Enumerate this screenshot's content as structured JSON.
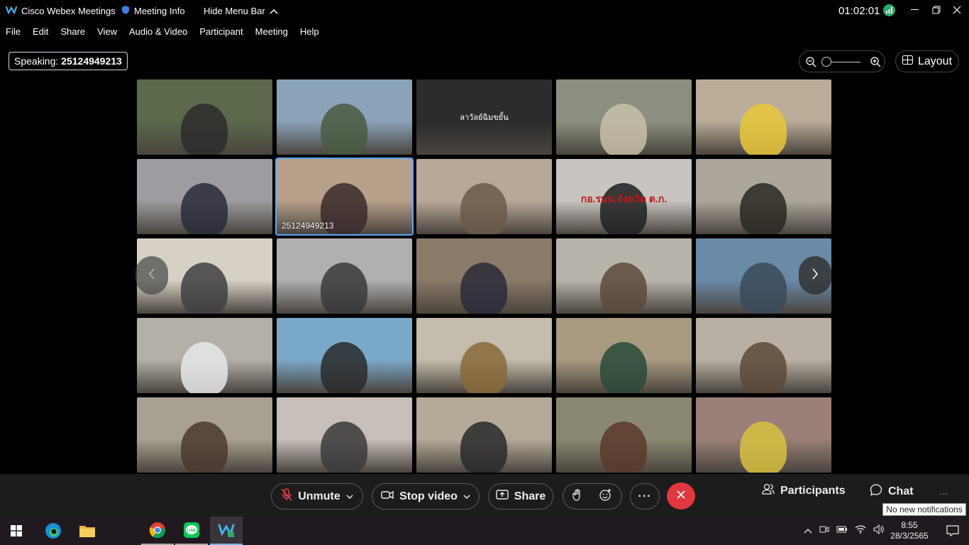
{
  "window": {
    "app_title": "Cisco Webex Meetings",
    "meeting_info": "Meeting Info",
    "hide_menu": "Hide Menu Bar",
    "timer": "01:02:01"
  },
  "menu": [
    "File",
    "Edit",
    "Share",
    "View",
    "Audio & Video",
    "Participant",
    "Meeting",
    "Help"
  ],
  "speaking": {
    "label": "Speaking:",
    "name": "25124949213"
  },
  "layout_label": "Layout",
  "tiles": [
    {
      "bg": "#5a6a4a",
      "fg": "#2b2b2b",
      "label": ""
    },
    {
      "bg": "#8aa3b8",
      "fg": "#4a5a40",
      "label": ""
    },
    {
      "bg": "#2c2c2c",
      "fg": "",
      "label": "",
      "text": "ลาวัลย์ฉิมขยั้น"
    },
    {
      "bg": "#8c8f80",
      "fg": "#c8c0a8",
      "label": ""
    },
    {
      "bg": "#b9ad98",
      "fg": "#e8c838",
      "label": ""
    },
    {
      "bg": "#9e9ca0",
      "fg": "#2a2a3a",
      "label": ""
    },
    {
      "bg": "#b8a08a",
      "fg": "#3a2a2a",
      "label": "25124949213",
      "active": true
    },
    {
      "bg": "#b8a898",
      "fg": "#6a5a4a",
      "label": ""
    },
    {
      "bg": "#c8c4c0",
      "fg": "#202020",
      "label": "",
      "text": "กอ.รมน.จังหวัด ต.ก."
    },
    {
      "bg": "#aca69c",
      "fg": "#2a2822",
      "label": ""
    },
    {
      "bg": "#d6d0c6",
      "fg": "#404040",
      "label": ""
    },
    {
      "bg": "#b0b0b0",
      "fg": "#3a3a3a",
      "label": ""
    },
    {
      "bg": "#8a7a68",
      "fg": "#2a2a3a",
      "label": ""
    },
    {
      "bg": "#b8b4ac",
      "fg": "#5a4a3a",
      "label": ""
    },
    {
      "bg": "#6a8aa8",
      "fg": "#3a4a5a",
      "label": ""
    },
    {
      "bg": "#b4b0a8",
      "fg": "#e8e8e8",
      "label": ""
    },
    {
      "bg": "#7aa8c8",
      "fg": "#2a2a2a",
      "label": ""
    },
    {
      "bg": "#c4bcac",
      "fg": "#8a6a3a",
      "label": ""
    },
    {
      "bg": "#a89a80",
      "fg": "#2a4a3a",
      "label": ""
    },
    {
      "bg": "#b8b0a4",
      "fg": "#5a4a3a",
      "label": ""
    },
    {
      "bg": "#a8a090",
      "fg": "#4a3a30",
      "label": ""
    },
    {
      "bg": "#c8c0b8",
      "fg": "#3a3a3a",
      "label": ""
    },
    {
      "bg": "#b4aa98",
      "fg": "#2a2a2a",
      "label": ""
    },
    {
      "bg": "#8a8870",
      "fg": "#5a3a2a",
      "label": ""
    },
    {
      "bg": "#9a8078",
      "fg": "#d8c040",
      "label": ""
    }
  ],
  "controls": {
    "unmute": "Unmute",
    "stop_video": "Stop video",
    "share": "Share",
    "participants": "Participants",
    "chat": "Chat"
  },
  "tooltip": "No new notifications",
  "taskbar": {
    "time": "8:55",
    "date": "28/3/2565"
  },
  "colors": {
    "end_call": "#e0383e",
    "accent": "#5aa7ff"
  }
}
